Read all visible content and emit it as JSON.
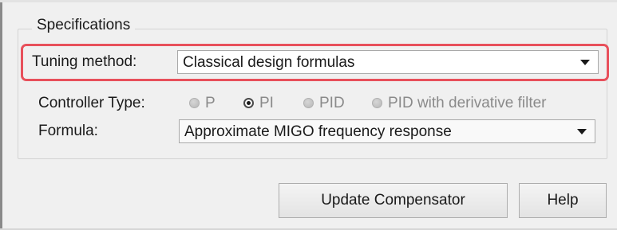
{
  "specifications": {
    "group_title": "Specifications",
    "tuning_method": {
      "label": "Tuning method:",
      "selected": "Classical design formulas"
    },
    "controller_type": {
      "label": "Controller Type:",
      "options": [
        {
          "label": "P",
          "selected": false
        },
        {
          "label": "PI",
          "selected": true
        },
        {
          "label": "PID",
          "selected": false
        },
        {
          "label": "PID with derivative filter",
          "selected": false
        }
      ]
    },
    "formula": {
      "label": "Formula:",
      "selected": "Approximate MIGO frequency response"
    }
  },
  "buttons": {
    "update_label": "Update Compensator",
    "help_label": "Help"
  },
  "colors": {
    "highlight": "#e8505b",
    "background": "#f0f0f0"
  }
}
